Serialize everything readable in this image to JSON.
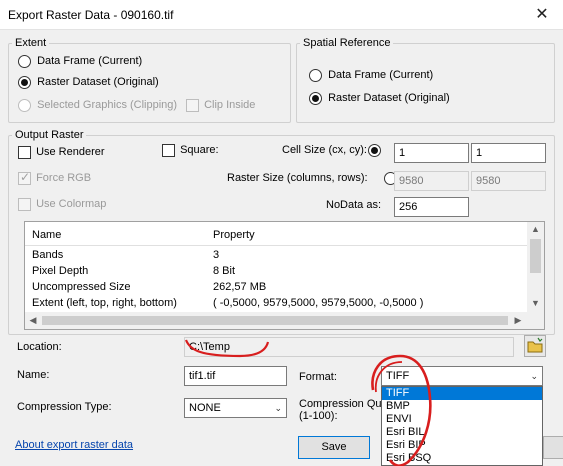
{
  "window": {
    "title": "Export Raster Data - 090160.tif",
    "close_glyph": "✕"
  },
  "extent": {
    "label": "Extent",
    "options": [
      {
        "label": "Data Frame (Current)",
        "selected": false,
        "enabled": true
      },
      {
        "label": "Raster Dataset (Original)",
        "selected": true,
        "enabled": true
      },
      {
        "label": "Selected Graphics (Clipping)",
        "selected": false,
        "enabled": false
      }
    ],
    "clip_inside": "Clip Inside"
  },
  "spatial_reference": {
    "label": "Spatial Reference",
    "options": [
      {
        "label": "Data Frame (Current)",
        "selected": false
      },
      {
        "label": "Raster Dataset (Original)",
        "selected": true
      }
    ]
  },
  "output_raster": {
    "label": "Output Raster",
    "use_renderer": "Use Renderer",
    "force_rgb": "Force RGB",
    "use_colormap": "Use Colormap",
    "square": "Square:",
    "cell_size_label": "Cell Size (cx, cy):",
    "cell_size_x": "1",
    "cell_size_y": "1",
    "raster_size_label": "Raster Size (columns, rows):",
    "raster_cols": "9580",
    "raster_rows": "9580",
    "nodata_label": "NoData as:",
    "nodata_value": "256"
  },
  "properties": {
    "headers": [
      "Name",
      "Property"
    ],
    "rows": [
      [
        "Bands",
        "3"
      ],
      [
        "Pixel Depth",
        "8 Bit"
      ],
      [
        "Uncompressed Size",
        "262,57 MB"
      ],
      [
        "Extent (left, top, right, bottom)",
        "( -0,5000, 9579,5000, 9579,5000, -0,5000 )"
      ]
    ]
  },
  "location": {
    "label": "Location:",
    "value": "C:\\Temp"
  },
  "name": {
    "label": "Name:",
    "value": "tif1.tif"
  },
  "format": {
    "label": "Format:",
    "value": "TIFF",
    "options": [
      "TIFF",
      "BMP",
      "ENVI",
      "Esri BIL",
      "Esri BIP",
      "Esri BSQ"
    ]
  },
  "compression": {
    "type_label": "Compression Type:",
    "type_value": "NONE",
    "quality_label_1": "Compression Qu",
    "quality_label_2": "(1-100):"
  },
  "footer": {
    "about_link": "About export raster data",
    "save_label": "Save"
  },
  "annotation_color": "#d81e1e"
}
